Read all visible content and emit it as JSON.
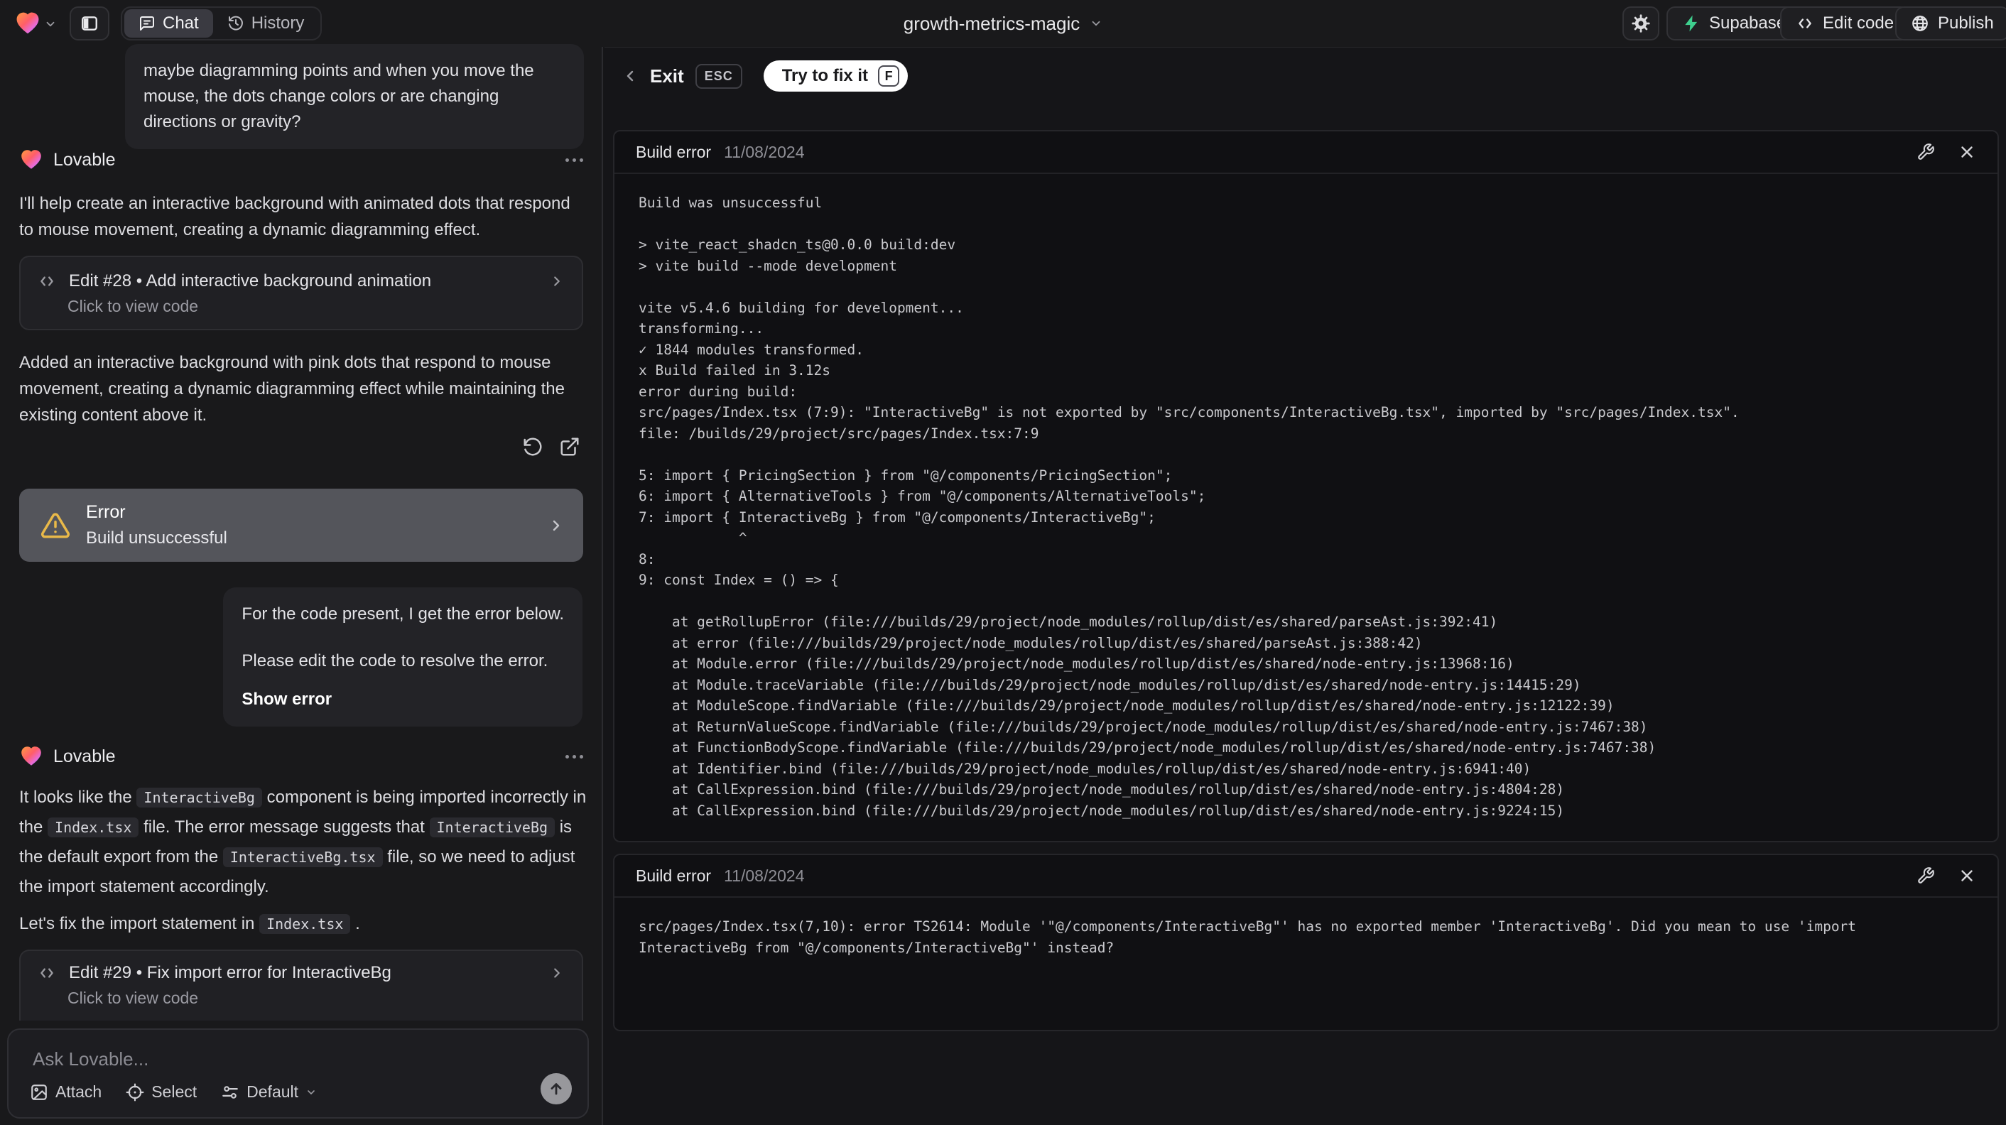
{
  "header": {
    "project_name": "growth-metrics-magic",
    "tab_chat": "Chat",
    "tab_history": "History",
    "btn_supabase": "Supabase",
    "btn_edit_code": "Edit code",
    "btn_publish": "Publish"
  },
  "chat": {
    "assistant_name": "Lovable",
    "user_message_1": "maybe diagramming points and when you move the mouse, the dots change colors or are changing directions or gravity?",
    "assistant_intro": "I'll help create an interactive background with animated dots that respond to mouse movement, creating a dynamic diagramming effect.",
    "edit_card_28": {
      "title": "Edit #28 • Add interactive background animation",
      "subtitle": "Click to view code"
    },
    "assistant_summary": "Added an interactive background with pink dots that respond to mouse movement, creating a dynamic diagramming effect while maintaining the existing content above it.",
    "error_card": {
      "title": "Error",
      "subtitle": "Build unsuccessful"
    },
    "user_message_2": {
      "line1": "For the code present, I get the error below.",
      "line2": "Please edit the code to resolve the error.",
      "action": "Show error"
    },
    "assistant_fix_rich": [
      {
        "text": "It looks like the "
      },
      {
        "code": "InteractiveBg"
      },
      {
        "text": " component is being imported incorrectly in the "
      },
      {
        "code": "Index.tsx"
      },
      {
        "text": " file. The error message suggests that "
      },
      {
        "code": "InteractiveBg"
      },
      {
        "text": " is the default export from the "
      },
      {
        "code": "InteractiveBg.tsx"
      },
      {
        "text": " file, so we need to adjust the import statement accordingly."
      }
    ],
    "assistant_fix2_rich": [
      {
        "text": "Let's fix the import statement in "
      },
      {
        "code": "Index.tsx"
      },
      {
        "text": " ."
      }
    ],
    "edit_card_29": {
      "title": "Edit #29 • Fix import error for InteractiveBg",
      "subtitle": "Click to view code"
    },
    "composer": {
      "placeholder": "Ask Lovable...",
      "attach": "Attach",
      "select": "Select",
      "mode": "Default"
    }
  },
  "error_view": {
    "exit_label": "Exit",
    "esc_key": "ESC",
    "fix_label": "Try to fix it",
    "fix_key": "F",
    "card1": {
      "title": "Build error",
      "date": "11/08/2024",
      "log": "Build was unsuccessful\n\n> vite_react_shadcn_ts@0.0.0 build:dev\n> vite build --mode development\n\nvite v5.4.6 building for development...\ntransforming...\n✓ 1844 modules transformed.\nx Build failed in 3.12s\nerror during build:\nsrc/pages/Index.tsx (7:9): \"InteractiveBg\" is not exported by \"src/components/InteractiveBg.tsx\", imported by \"src/pages/Index.tsx\".\nfile: /builds/29/project/src/pages/Index.tsx:7:9\n\n5: import { PricingSection } from \"@/components/PricingSection\";\n6: import { AlternativeTools } from \"@/components/AlternativeTools\";\n7: import { InteractiveBg } from \"@/components/InteractiveBg\";\n            ^\n8: \n9: const Index = () => {\n\n    at getRollupError (file:///builds/29/project/node_modules/rollup/dist/es/shared/parseAst.js:392:41)\n    at error (file:///builds/29/project/node_modules/rollup/dist/es/shared/parseAst.js:388:42)\n    at Module.error (file:///builds/29/project/node_modules/rollup/dist/es/shared/node-entry.js:13968:16)\n    at Module.traceVariable (file:///builds/29/project/node_modules/rollup/dist/es/shared/node-entry.js:14415:29)\n    at ModuleScope.findVariable (file:///builds/29/project/node_modules/rollup/dist/es/shared/node-entry.js:12122:39)\n    at ReturnValueScope.findVariable (file:///builds/29/project/node_modules/rollup/dist/es/shared/node-entry.js:7467:38)\n    at FunctionBodyScope.findVariable (file:///builds/29/project/node_modules/rollup/dist/es/shared/node-entry.js:7467:38)\n    at Identifier.bind (file:///builds/29/project/node_modules/rollup/dist/es/shared/node-entry.js:6941:40)\n    at CallExpression.bind (file:///builds/29/project/node_modules/rollup/dist/es/shared/node-entry.js:4804:28)\n    at CallExpression.bind (file:///builds/29/project/node_modules/rollup/dist/es/shared/node-entry.js:9224:15)"
    },
    "card2": {
      "title": "Build error",
      "date": "11/08/2024",
      "log": "src/pages/Index.tsx(7,10): error TS2614: Module '\"@/components/InteractiveBg\"' has no exported member 'InteractiveBg'. Did you mean to use 'import\nInteractiveBg from \"@/components/InteractiveBg\"' instead?"
    }
  },
  "colors": {
    "accent_green": "#3ecf8e",
    "warning": "#e9b949"
  }
}
